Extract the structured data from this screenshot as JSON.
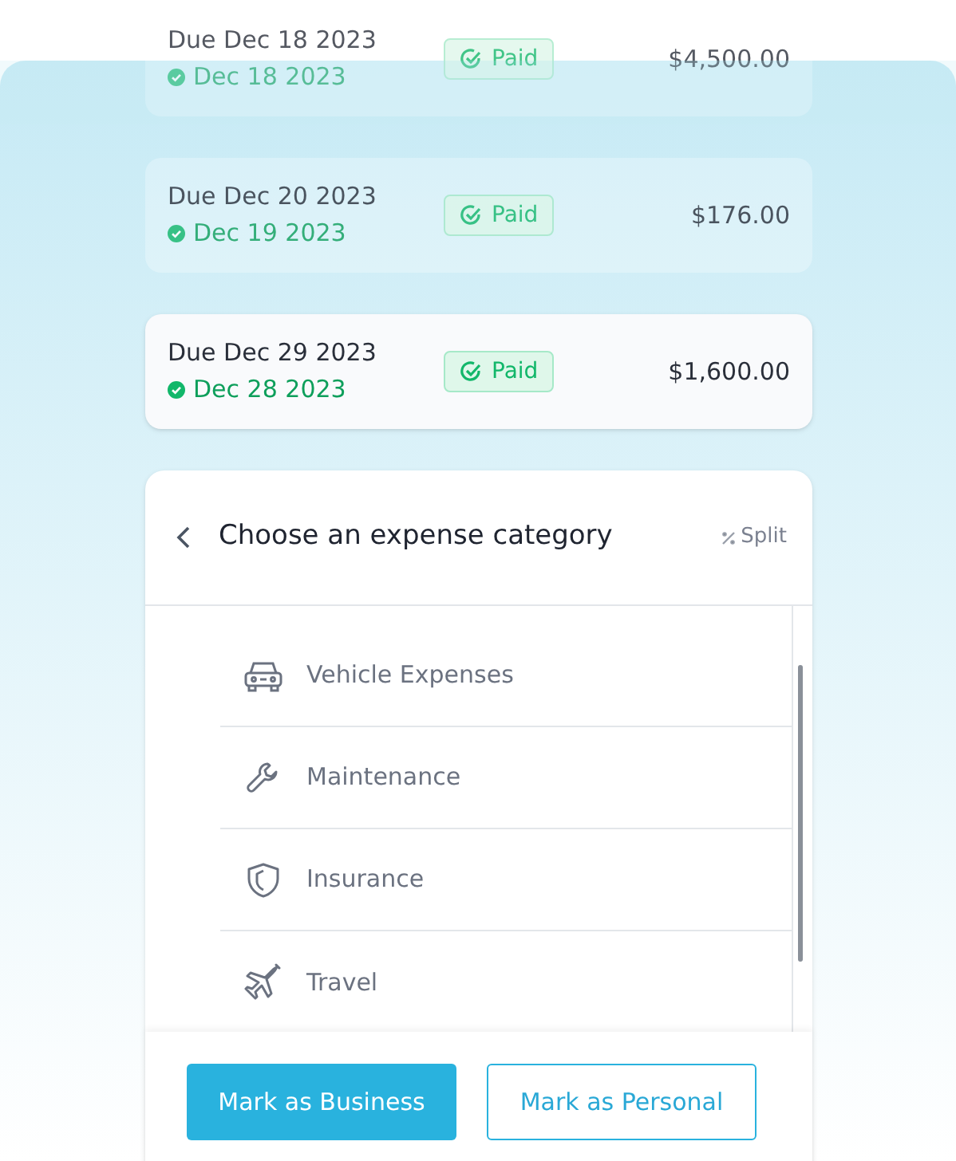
{
  "invoices": [
    {
      "due": "Due Dec 18 2023",
      "paid_date": "Dec 18 2023",
      "status": "Paid",
      "amount": "$4,500.00",
      "dimmed": true
    },
    {
      "due": "Due Dec 20 2023",
      "paid_date": "Dec 19 2023",
      "status": "Paid",
      "amount": "$176.00",
      "dimmed": true
    },
    {
      "due": "Due Dec 29 2023",
      "paid_date": "Dec 28 2023",
      "status": "Paid",
      "amount": "$1,600.00",
      "dimmed": false
    }
  ],
  "category_sheet": {
    "title": "Choose an expense category",
    "split": "Split",
    "categories": [
      {
        "label": "Vehicle Expenses",
        "kind": "car"
      },
      {
        "label": "Maintenance",
        "kind": "wrench"
      },
      {
        "label": "Insurance",
        "kind": "shield"
      },
      {
        "label": "Travel",
        "kind": "plane"
      }
    ],
    "buttons": [
      {
        "label": "Mark as Business",
        "kind": "primary"
      },
      {
        "label": "Mark as Personal",
        "kind": "outline"
      }
    ]
  }
}
